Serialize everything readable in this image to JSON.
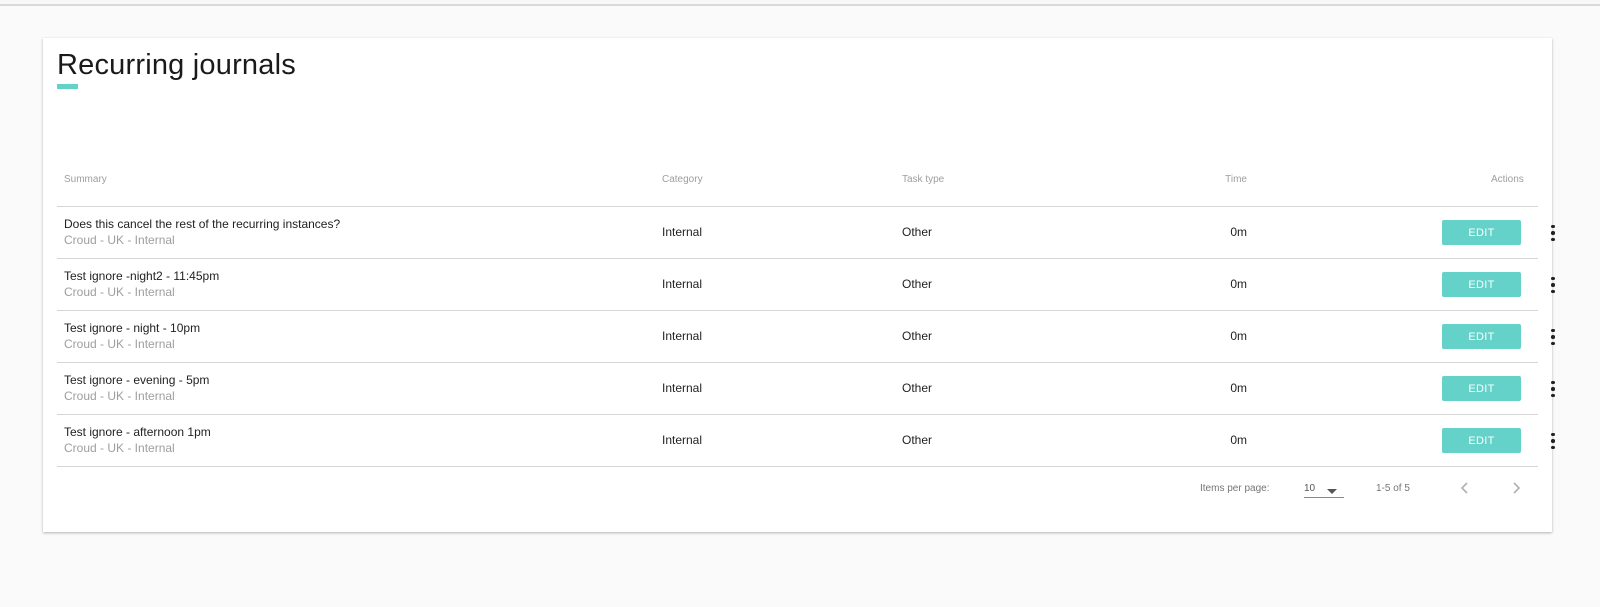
{
  "page": {
    "title": "Recurring journals"
  },
  "colors": {
    "accent": "#64d2c8",
    "muted_text": "#9e9e9e",
    "divider": "#d6d6d6"
  },
  "table": {
    "headers": {
      "summary": "Summary",
      "category": "Category",
      "task_type": "Task type",
      "time": "Time",
      "actions": "Actions"
    },
    "rows": [
      {
        "summary": "Does this cancel the rest of the recurring instances?",
        "subtitle": "Croud - UK - Internal",
        "category": "Internal",
        "task_type": "Other",
        "time": "0m",
        "edit_label": "EDIT"
      },
      {
        "summary": "Test ignore -night2 - 11:45pm",
        "subtitle": "Croud - UK - Internal",
        "category": "Internal",
        "task_type": "Other",
        "time": "0m",
        "edit_label": "EDIT"
      },
      {
        "summary": "Test ignore - night - 10pm",
        "subtitle": "Croud - UK - Internal",
        "category": "Internal",
        "task_type": "Other",
        "time": "0m",
        "edit_label": "EDIT"
      },
      {
        "summary": "Test ignore - evening - 5pm",
        "subtitle": "Croud - UK - Internal",
        "category": "Internal",
        "task_type": "Other",
        "time": "0m",
        "edit_label": "EDIT"
      },
      {
        "summary": "Test ignore - afternoon 1pm",
        "subtitle": "Croud - UK - Internal",
        "category": "Internal",
        "task_type": "Other",
        "time": "0m",
        "edit_label": "EDIT"
      }
    ]
  },
  "paginator": {
    "items_per_page_label": "Items per page:",
    "items_per_page_value": "10",
    "range_label": "1-5 of 5",
    "prev_icon": "chevron-left-icon",
    "next_icon": "chevron-right-icon"
  }
}
